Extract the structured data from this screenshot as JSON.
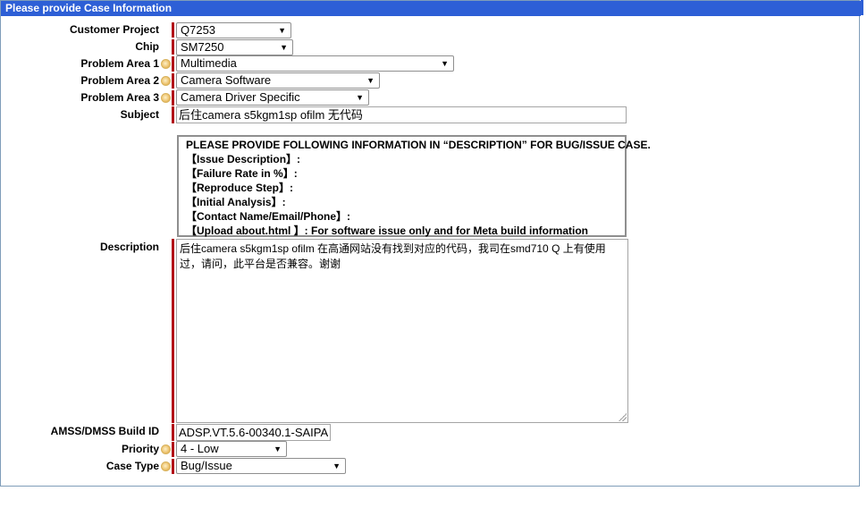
{
  "section_title": "Please provide Case Information",
  "fields": {
    "customer_project": {
      "label": "Customer Project",
      "value": "Q7253"
    },
    "chip": {
      "label": "Chip",
      "value": "SM7250"
    },
    "problem_area_1": {
      "label": "Problem Area 1",
      "value": "Multimedia"
    },
    "problem_area_2": {
      "label": "Problem Area 2",
      "value": "Camera Software"
    },
    "problem_area_3": {
      "label": "Problem Area 3",
      "value": "Camera Driver Specific"
    },
    "subject": {
      "label": "Subject",
      "value": "后住camera s5kgm1sp ofilm  无代码"
    },
    "description": {
      "label": "Description",
      "value": "后住camera s5kgm1sp ofilm  在高通网站没有找到对应的代码，我司在smd710 Q 上有使用过，请问，此平台是否兼容。谢谢"
    },
    "build_id": {
      "label": "AMSS/DMSS Build ID",
      "value": "ADSP.VT.5.6-00340.1-SAIPA"
    },
    "priority": {
      "label": "Priority",
      "value": "4 - Low"
    },
    "case_type": {
      "label": "Case Type",
      "value": "Bug/Issue"
    }
  },
  "info_box": {
    "heading": "PLEASE PROVIDE FOLLOWING INFORMATION IN “DESCRIPTION” FOR BUG/ISSUE CASE.",
    "lines": [
      "【Issue Description】:",
      "【Failure Rate in %】:",
      "【Reproduce Step】:",
      "【Initial Analysis】:",
      "【Contact Name/Email/Phone】:",
      "【Upload about.html 】: For software issue only and for Meta build information"
    ]
  },
  "icons": {
    "help": "help-icon",
    "dropdown": "dropdown-arrow-icon"
  },
  "colors": {
    "header": "#2d5fd6",
    "required_bar": "#b21218"
  }
}
